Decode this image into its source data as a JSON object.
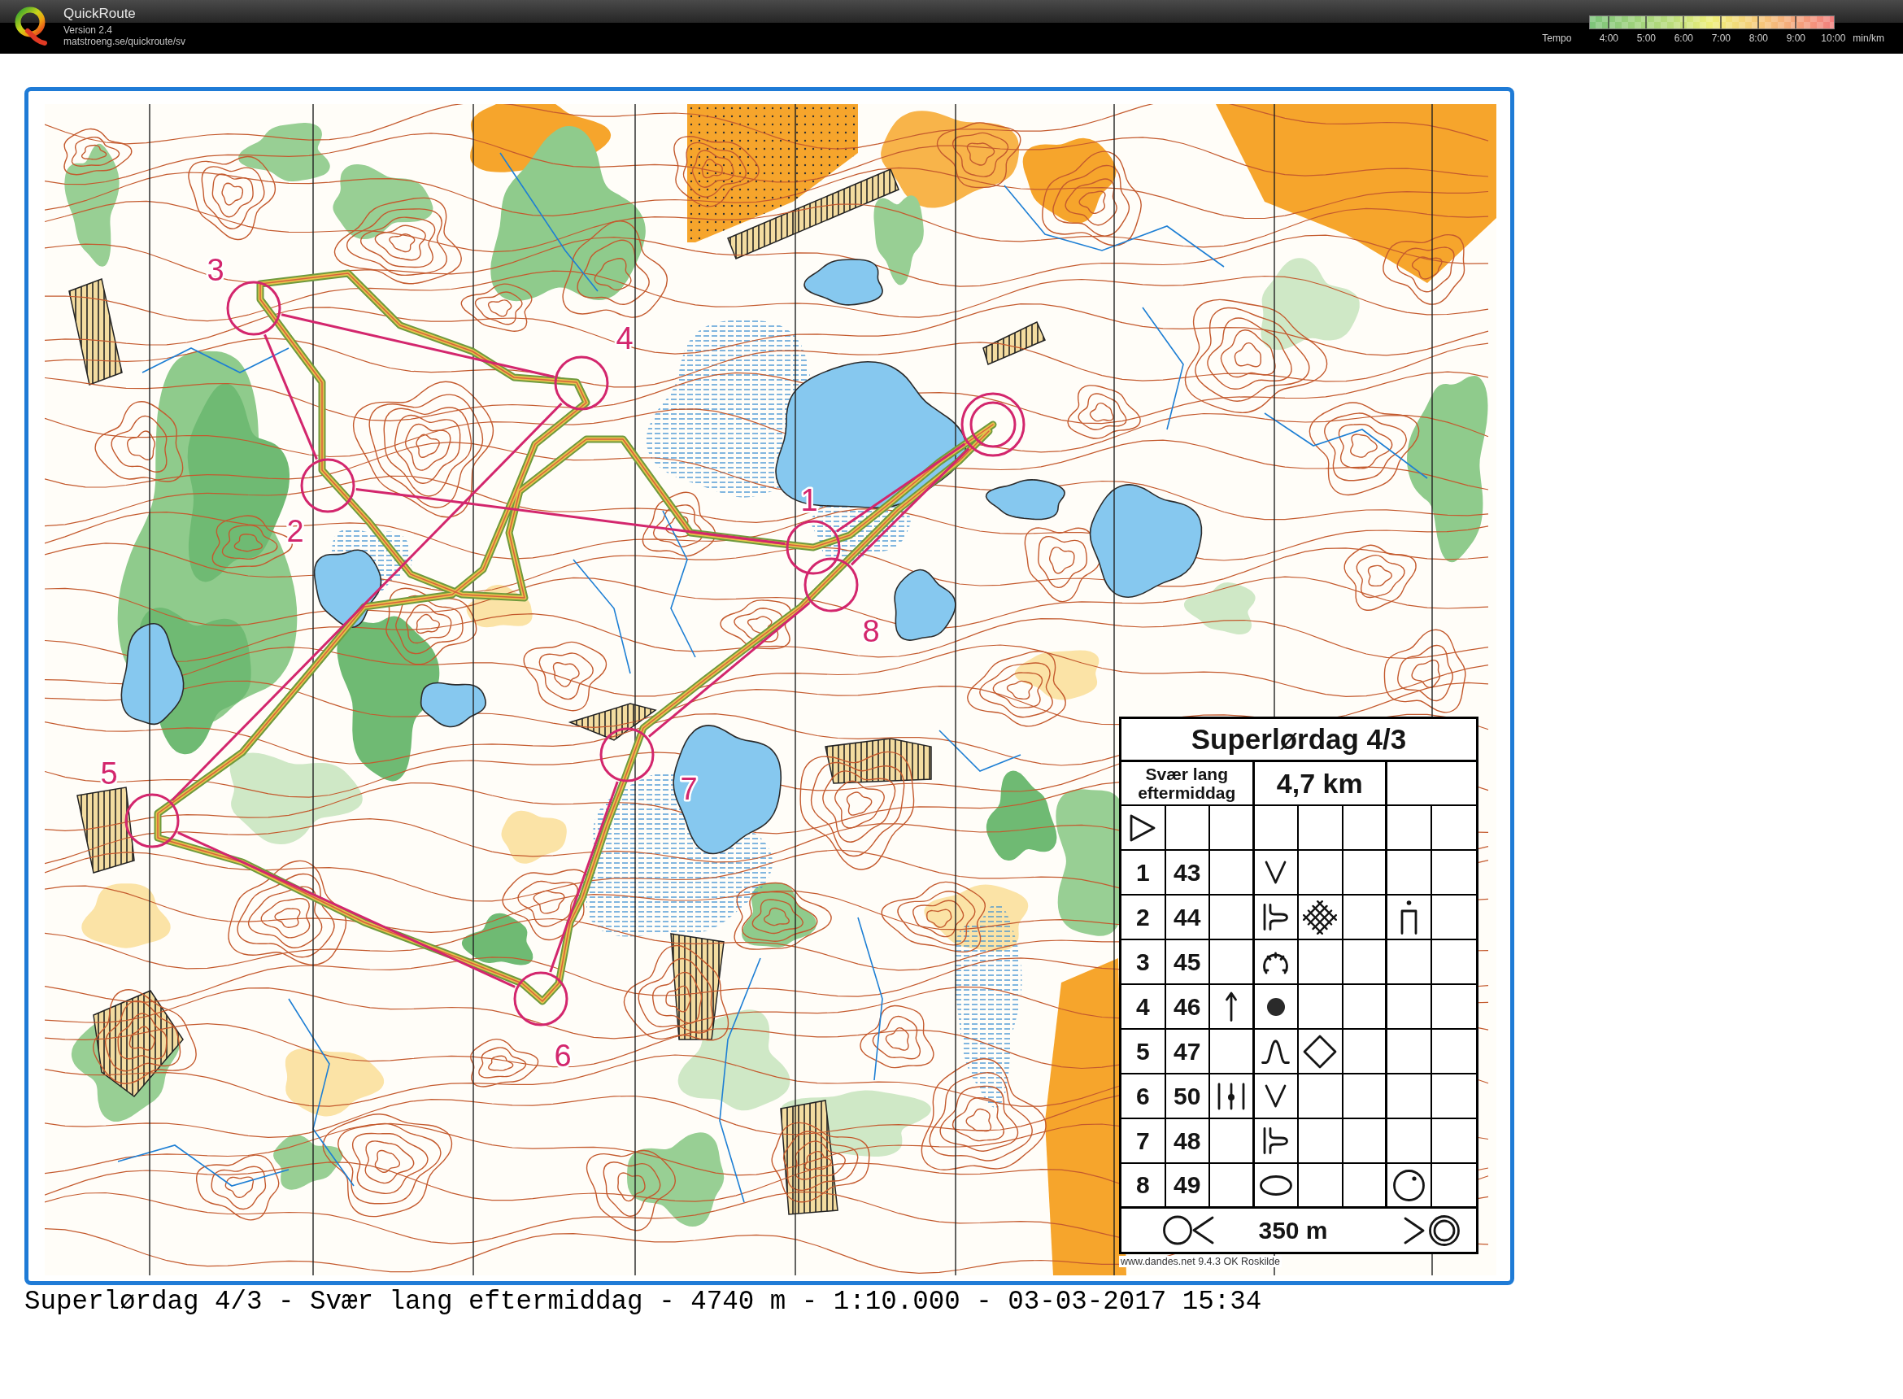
{
  "app": {
    "title": "QuickRoute",
    "version": "Version 2.4",
    "url": "matstroeng.se/quickroute/sv"
  },
  "tempo_legend": {
    "label": "Tempo",
    "ticks": [
      "4:00",
      "5:00",
      "6:00",
      "7:00",
      "8:00",
      "9:00",
      "10:00"
    ],
    "unit": "min/km"
  },
  "map": {
    "controls": [
      {
        "number": "1"
      },
      {
        "number": "2"
      },
      {
        "number": "3"
      },
      {
        "number": "4"
      },
      {
        "number": "5"
      },
      {
        "number": "6"
      },
      {
        "number": "7"
      },
      {
        "number": "8"
      }
    ],
    "description_sheet": {
      "title": "Superlørdag 4/3",
      "class": "Svær lang eftermiddag",
      "length": "4,7 km",
      "controls": [
        {
          "number": "1",
          "code": "43"
        },
        {
          "number": "2",
          "code": "44"
        },
        {
          "number": "3",
          "code": "45"
        },
        {
          "number": "4",
          "code": "46"
        },
        {
          "number": "5",
          "code": "47"
        },
        {
          "number": "6",
          "code": "50"
        },
        {
          "number": "7",
          "code": "48"
        },
        {
          "number": "8",
          "code": "49"
        }
      ],
      "finish_distance": "350 m"
    },
    "credit": "www.dandes.net 9.4.3 OK Roskilde"
  },
  "caption": "Superlørdag 4/3 - Svær lang eftermiddag - 4740 m - 1:10.000 - 03-03-2017 15:34"
}
